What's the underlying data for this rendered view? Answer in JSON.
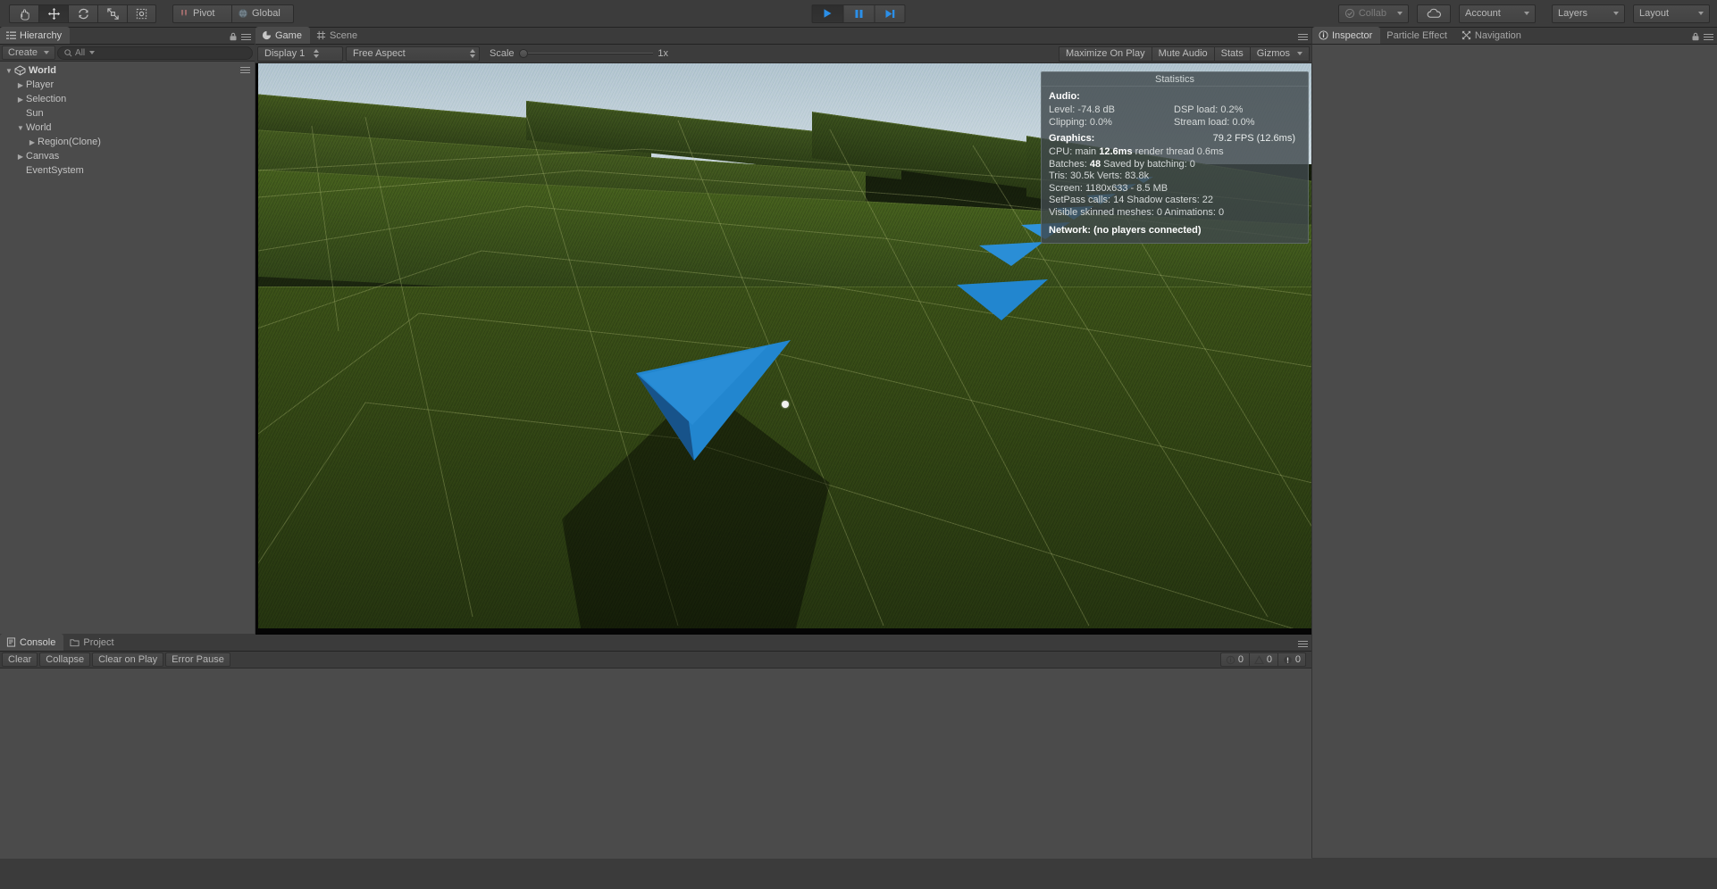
{
  "toolbar": {
    "tools": [
      {
        "name": "hand-tool",
        "label": "Hand",
        "active": false
      },
      {
        "name": "move-tool",
        "label": "Move",
        "active": true
      },
      {
        "name": "rotate-tool",
        "label": "Rotate",
        "active": false
      },
      {
        "name": "scale-tool",
        "label": "Scale",
        "active": false
      },
      {
        "name": "rect-tool",
        "label": "Rect",
        "active": false
      }
    ],
    "pivot_label": "Pivot",
    "global_label": "Global",
    "play_label": "Play",
    "pause_label": "Pause",
    "step_label": "Step",
    "collab_label": "Collab",
    "cloud_label": "Services",
    "account_label": "Account",
    "layers_label": "Layers",
    "layout_label": "Layout"
  },
  "hierarchy": {
    "tab_label": "Hierarchy",
    "create_label": "Create",
    "search_placeholder": "All",
    "search_value": "",
    "items": [
      {
        "label": "World",
        "depth": 0,
        "arrow": "down",
        "icon": true,
        "bold": true
      },
      {
        "label": "Player",
        "depth": 1,
        "arrow": "right",
        "icon": false,
        "bold": false
      },
      {
        "label": "Selection",
        "depth": 1,
        "arrow": "right",
        "icon": false,
        "bold": false
      },
      {
        "label": "Sun",
        "depth": 1,
        "arrow": "none",
        "icon": false,
        "bold": false
      },
      {
        "label": "World",
        "depth": 1,
        "arrow": "down",
        "icon": false,
        "bold": false
      },
      {
        "label": "Region(Clone)",
        "depth": 2,
        "arrow": "right",
        "icon": false,
        "bold": false
      },
      {
        "label": "Canvas",
        "depth": 1,
        "arrow": "right",
        "icon": false,
        "bold": false
      },
      {
        "label": "EventSystem",
        "depth": 1,
        "arrow": "none",
        "icon": false,
        "bold": false
      }
    ]
  },
  "gameview": {
    "tabs": [
      {
        "label": "Game",
        "active": true,
        "icon": "game-icon"
      },
      {
        "label": "Scene",
        "active": false,
        "icon": "scene-icon"
      }
    ],
    "display_label": "Display 1",
    "aspect_label": "Free Aspect",
    "scale_label": "Scale",
    "scale_value": "1x",
    "maximize_label": "Maximize On Play",
    "mute_label": "Mute Audio",
    "stats_label": "Stats",
    "gizmos_label": "Gizmos"
  },
  "statistics": {
    "title": "Statistics",
    "audio_heading": "Audio:",
    "audio": [
      {
        "left": "Level: -74.8 dB",
        "right": "DSP load: 0.2%"
      },
      {
        "left": "Clipping: 0.0%",
        "right": "Stream load: 0.0%"
      }
    ],
    "graphics_heading": "Graphics:",
    "fps": "79.2 FPS (12.6ms)",
    "graphics": [
      "CPU: main 12.6ms  render thread 0.6ms",
      "Batches: 48          Saved by batching: 0",
      "Tris: 30.5k          Verts: 83.8k",
      "Screen: 1180x633 - 8.5 MB",
      "SetPass calls: 14    Shadow casters: 22",
      "Visible skinned meshes: 0  Animations: 0"
    ],
    "network": "Network: (no players connected)"
  },
  "inspector": {
    "tabs": [
      {
        "label": "Inspector",
        "active": true,
        "icon": "info-icon"
      },
      {
        "label": "Particle Effect",
        "active": false,
        "icon": "none"
      },
      {
        "label": "Navigation",
        "active": false,
        "icon": "navigation-icon"
      }
    ]
  },
  "console": {
    "tabs": [
      {
        "label": "Console",
        "active": true,
        "icon": "console-icon"
      },
      {
        "label": "Project",
        "active": false,
        "icon": "folder-icon"
      }
    ],
    "clear_label": "Clear",
    "collapse_label": "Collapse",
    "clear_on_play_label": "Clear on Play",
    "error_pause_label": "Error Pause",
    "counts": {
      "info": "0",
      "warning": "0",
      "error": "0"
    }
  },
  "colors": {
    "chrome": "#3b3b3b",
    "panel": "#4b4b4b",
    "marker_blue": "#2080c8",
    "grass": "#33451a",
    "sky": "#cdd9e1",
    "play_accent": "#1a7fe0"
  }
}
